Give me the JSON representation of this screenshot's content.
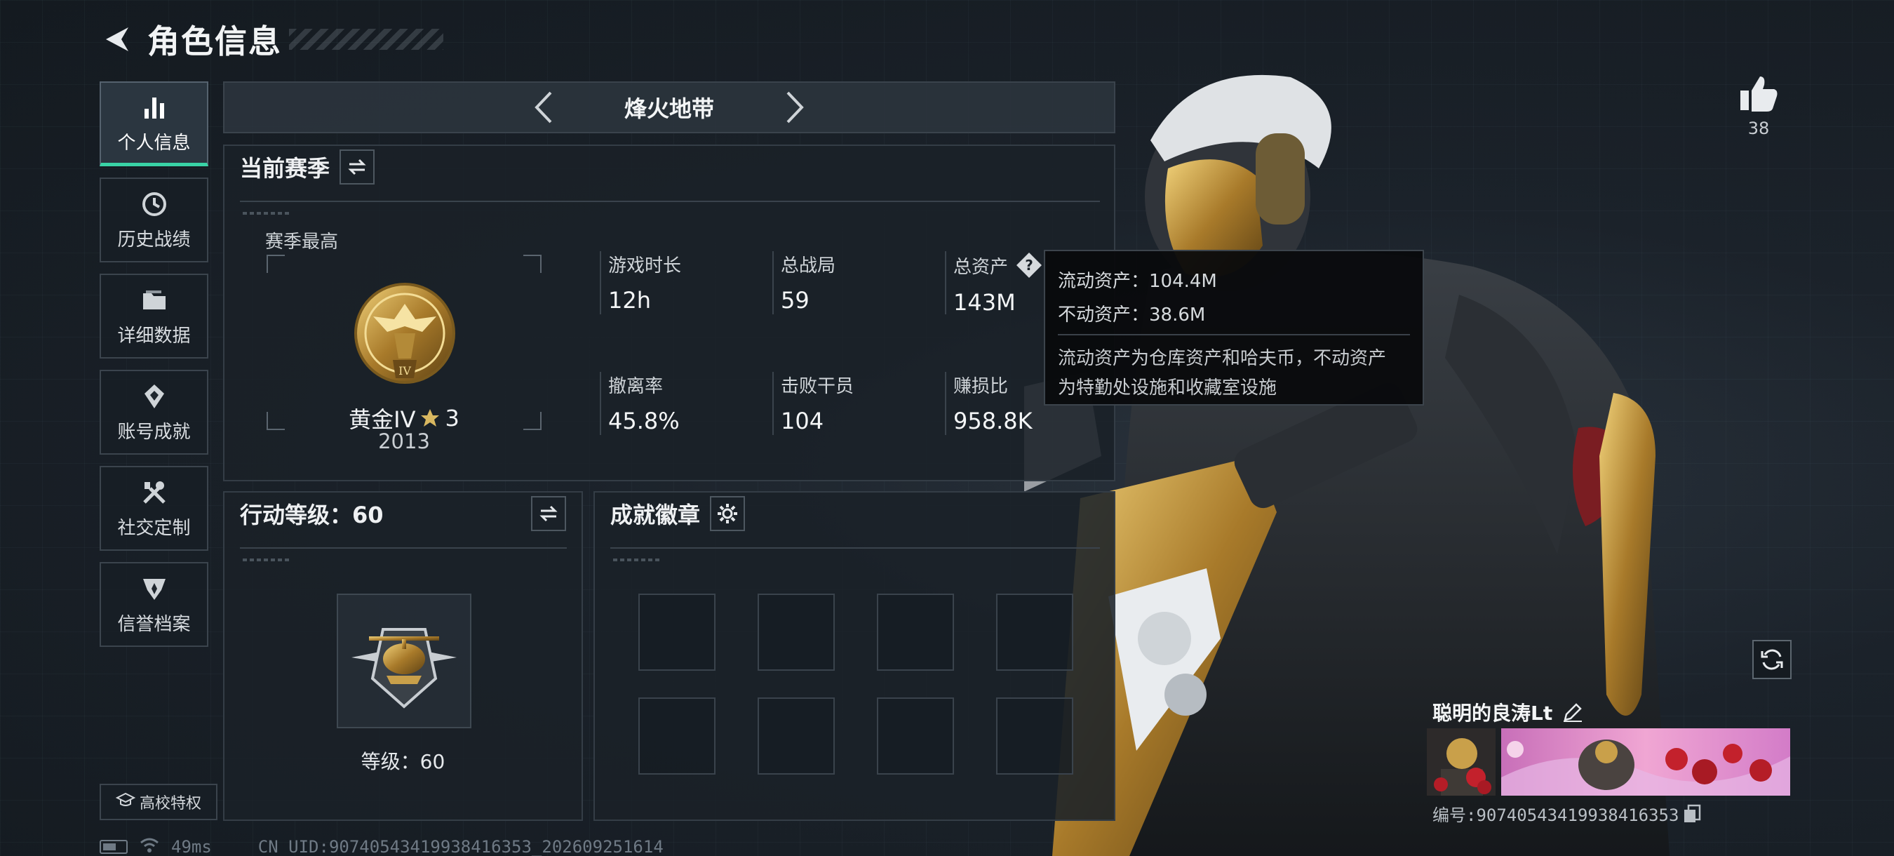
{
  "header": {
    "title": "角色信息"
  },
  "sidebar": {
    "items": [
      {
        "label": "个人信息",
        "icon": "bar-chart-icon"
      },
      {
        "label": "历史战绩",
        "icon": "history-clock-icon"
      },
      {
        "label": "详细数据",
        "icon": "folder-icon"
      },
      {
        "label": "账号成就",
        "icon": "achievement-icon"
      },
      {
        "label": "社交定制",
        "icon": "tools-icon"
      },
      {
        "label": "信誉档案",
        "icon": "credit-shield-icon"
      }
    ],
    "school_label": "高校特权"
  },
  "status": {
    "ping": "49ms",
    "uid": "CN UID:9074054341993841635З_202609251614"
  },
  "mode": {
    "title": "烽火地带"
  },
  "season": {
    "title": "当前赛季",
    "best_label": "赛季最高",
    "rank_name": "黄金IV",
    "rank_stars": "3",
    "rank_score": "2013",
    "stats": [
      {
        "label": "游戏时长",
        "value": "12h"
      },
      {
        "label": "总战局",
        "value": "59"
      },
      {
        "label": "总资产",
        "value": "143M"
      },
      {
        "label": "撤离率",
        "value": "45.8%"
      },
      {
        "label": "击败干员",
        "value": "104"
      },
      {
        "label": "赚损比",
        "value": "958.8K"
      }
    ]
  },
  "tooltip": {
    "liquid": "流动资产：104.4M",
    "fixed": "不动资产：38.6M",
    "desc_line1": "流动资产为仓库资产和哈夫币，不动资产",
    "desc_line2": "为特勤处设施和收藏室设施"
  },
  "level": {
    "title": "行动等级：60",
    "level_text": "等级：60"
  },
  "badges": {
    "title": "成就徽章"
  },
  "player": {
    "likes": "38",
    "name": "聪明的良涛Lt",
    "id_text": "编号:9074054341993841635З"
  },
  "colors": {
    "accent": "#39d3a6",
    "gold": "#c9a04a",
    "panel": "#1a2128"
  }
}
